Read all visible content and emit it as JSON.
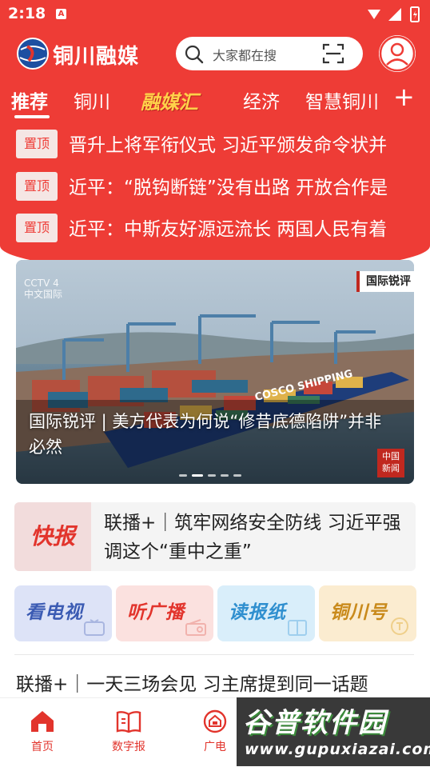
{
  "status_bar": {
    "time": "2:18",
    "notification_icon_letter": "A"
  },
  "header": {
    "logo_text": "铜川融媒",
    "search_placeholder": "大家都在搜"
  },
  "tabs": [
    {
      "label": "推荐",
      "active": true
    },
    {
      "label": "铜川",
      "active": false
    },
    {
      "label": "融媒汇",
      "active": false
    },
    {
      "label": "经济",
      "active": false
    },
    {
      "label": "智慧铜川",
      "active": false
    }
  ],
  "tabs_more": "+",
  "pinned": [
    {
      "badge": "置顶",
      "text": "晋升上将军衔仪式 习近平颁发命令状并"
    },
    {
      "badge": "置顶",
      "text": "近平：“脱钩断链”没有出路 开放合作是"
    },
    {
      "badge": "置顶",
      "text": "近平：中斯友好源远流长 两国人民有着"
    }
  ],
  "banner": {
    "caption": "国际锐评 | 美方代表为何说“修昔底德陷阱”并非必然",
    "corner_badge": "国际锐评",
    "broadcaster_mark": "CCTV 4",
    "broadcaster_sub": "中文国际",
    "news_badge_line1": "中国",
    "news_badge_line2": "新闻",
    "ship_text": "COSCO SHIPPING",
    "slide_count": 5,
    "active_slide": 2
  },
  "flash": {
    "logo": "快报",
    "text": "联播+｜筑牢网络安全防线 习近平强调这个“重中之重”"
  },
  "tiles": [
    {
      "label": "看电视",
      "color": "#3b5bb3",
      "bg": "#dde3f7",
      "icon": "tv-icon"
    },
    {
      "label": "听广播",
      "color": "#e2342c",
      "bg": "#fbe1df",
      "icon": "radio-icon"
    },
    {
      "label": "读报纸",
      "color": "#2f8fcf",
      "bg": "#d9eefa",
      "icon": "newspaper-icon"
    },
    {
      "label": "铜川号",
      "color": "#c98a1b",
      "bg": "#fbecd0",
      "icon": "channel-icon"
    }
  ],
  "headline": "联播+｜一天三场会见 习主席提到同一话题",
  "bottom_nav": [
    {
      "label": "首页",
      "icon": "home-icon"
    },
    {
      "label": "数字报",
      "icon": "digital-paper-icon"
    },
    {
      "label": "广电",
      "icon": "broadcast-icon"
    }
  ],
  "watermark": {
    "title": "谷普软件园",
    "url": "www.gupuxiazai.com"
  },
  "colors": {
    "brand_red": "#ee3c36",
    "accent_red": "#e2342c"
  }
}
